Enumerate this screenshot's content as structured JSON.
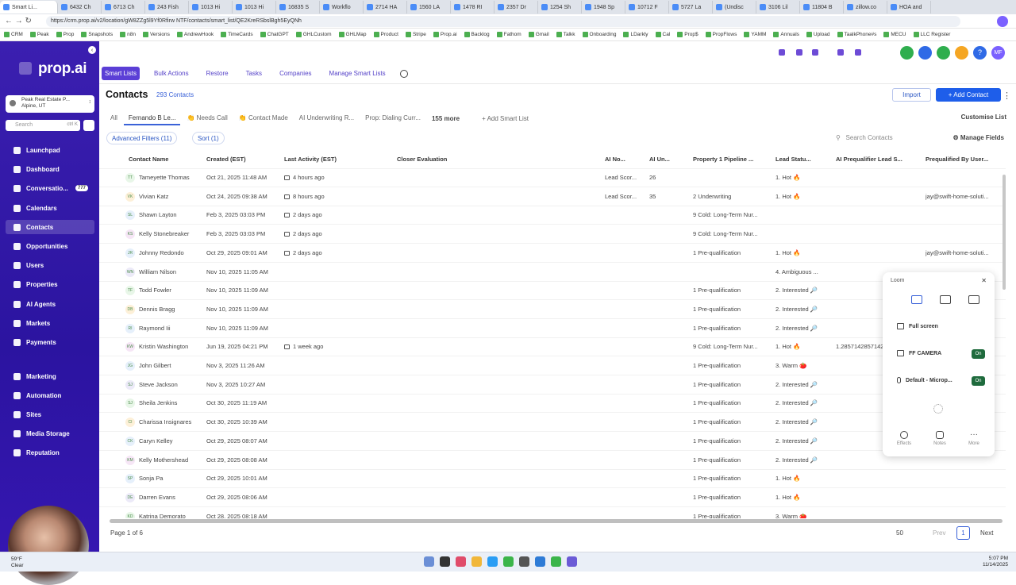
{
  "browser": {
    "tabs": [
      {
        "label": "Smart Li..."
      },
      {
        "label": "6432 Ch"
      },
      {
        "label": "6713 Ch"
      },
      {
        "label": "243 Fish"
      },
      {
        "label": "1013 Hi"
      },
      {
        "label": "1013 Hi"
      },
      {
        "label": "16835 S"
      },
      {
        "label": "Workflo"
      },
      {
        "label": "2714 HA"
      },
      {
        "label": "1560 LA"
      },
      {
        "label": "1478 RI"
      },
      {
        "label": "2357 Dr"
      },
      {
        "label": "1254 Sh"
      },
      {
        "label": "1948 Sp"
      },
      {
        "label": "10712 F"
      },
      {
        "label": "5727 La"
      },
      {
        "label": "(Undisc"
      },
      {
        "label": "3106 Lil"
      },
      {
        "label": "11804 B"
      },
      {
        "label": "zillow.co"
      },
      {
        "label": "HOA and"
      }
    ],
    "url": "https://crm.prop.ai/v2/location/gW8ZZg5l9Yf0Rfirw NTF/contacts/smart_list/QE2KreRSbslBgh5EyQNh",
    "bookmarks": [
      "CRM",
      "Peak",
      "Prop",
      "Snapshots",
      "n8n",
      "Versions",
      "AndrewHook",
      "TimeCards",
      "ChatGPT",
      "GHLCustom",
      "GHLMap",
      "Product",
      "Stripe",
      "Prop.ai",
      "Backlog",
      "Fathom",
      "Gmail",
      "Talkk",
      "Onboarding",
      "LDarkly",
      "Cal",
      "Prop$",
      "PropFlows",
      "YAMM",
      "Annuals",
      "Upload",
      "TaalkPhone#s",
      "MECU",
      "LLC Register"
    ]
  },
  "sidebar": {
    "logo": "prop.ai",
    "account_name": "Peak Real Estate P...",
    "account_location": "Alpine, UT",
    "search_placeholder": "Search",
    "search_shortcut": "ctrl K",
    "items": [
      {
        "label": "Launchpad"
      },
      {
        "label": "Dashboard"
      },
      {
        "label": "Conversatio...",
        "badge": "777"
      },
      {
        "label": "Calendars"
      },
      {
        "label": "Contacts"
      },
      {
        "label": "Opportunities"
      },
      {
        "label": "Users"
      },
      {
        "label": "Properties"
      },
      {
        "label": "AI Agents"
      },
      {
        "label": "Markets"
      },
      {
        "label": "Payments"
      },
      {
        "label": "Marketing"
      },
      {
        "label": "Automation"
      },
      {
        "label": "Sites"
      },
      {
        "label": "Media Storage"
      },
      {
        "label": "Reputation"
      }
    ]
  },
  "topbar": {
    "avatar_initials": "MF"
  },
  "subnav": {
    "tabs": [
      "Smart Lists",
      "Bulk Actions",
      "Restore",
      "Tasks",
      "Companies",
      "Manage Smart Lists"
    ]
  },
  "header": {
    "title": "Contacts",
    "count": "293 Contacts",
    "import_label": "Import",
    "add_label": "+ Add Contact"
  },
  "list_tabs": {
    "tabs": [
      "All",
      "Fernando B Le...",
      "👏 Needs Call",
      "👏 Contact Made",
      "AI Underwriting R...",
      "Prop: Dialing Curr..."
    ],
    "more": "155 more",
    "add": "+ Add Smart List",
    "customise": "Customise List"
  },
  "filters": {
    "advanced": "Advanced Filters (11)",
    "sort": "Sort (1)",
    "search_placeholder": "Search Contacts",
    "manage_fields": "Manage Fields"
  },
  "table": {
    "columns": [
      "Contact Name",
      "Created (EST)",
      "Last Activity (EST)",
      "Closer Evaluation",
      "AI No...",
      "AI Un...",
      "Property 1 Pipeline ...",
      "Lead Statu...",
      "AI Prequalifier Lead S...",
      "Prequalified By User..."
    ],
    "rows": [
      {
        "initials": "TT",
        "name": "Tameyette Thomas",
        "created": "Oct 21, 2025 11:48 AM",
        "activity": "4 hours ago",
        "ai_no": "Lead Scor...",
        "ai_un": "26",
        "pipeline": "",
        "status": "1. Hot 🔥",
        "prequal_score": "",
        "prequal_by": ""
      },
      {
        "initials": "VK",
        "name": "Vivian Katz",
        "created": "Oct 24, 2025 09:38 AM",
        "activity": "8 hours ago",
        "ai_no": "Lead Scor...",
        "ai_un": "35",
        "pipeline": "2 Underwriting",
        "status": "1. Hot 🔥",
        "prequal_score": "",
        "prequal_by": "jay@swift-home-soluti..."
      },
      {
        "initials": "SL",
        "name": "Shawn Layton",
        "created": "Feb 3, 2025 03:03 PM",
        "activity": "2 days ago",
        "ai_no": "",
        "ai_un": "",
        "pipeline": "9 Cold: Long-Term Nur...",
        "status": "",
        "prequal_score": "",
        "prequal_by": ""
      },
      {
        "initials": "KS",
        "name": "Kelly Stonebreaker",
        "created": "Feb 3, 2025 03:03 PM",
        "activity": "2 days ago",
        "ai_no": "",
        "ai_un": "",
        "pipeline": "9 Cold: Long-Term Nur...",
        "status": "",
        "prequal_score": "",
        "prequal_by": ""
      },
      {
        "initials": "JR",
        "name": "Johnny Redondo",
        "created": "Oct 29, 2025 09:01 AM",
        "activity": "2 days ago",
        "ai_no": "",
        "ai_un": "",
        "pipeline": "1 Pre-qualification",
        "status": "1. Hot 🔥",
        "prequal_score": "",
        "prequal_by": "jay@swift-home-soluti..."
      },
      {
        "initials": "WN",
        "name": "William Nilson",
        "created": "Nov 10, 2025 11:05 AM",
        "activity": "",
        "ai_no": "",
        "ai_un": "",
        "pipeline": "",
        "status": "4. Ambiguous ...",
        "prequal_score": "",
        "prequal_by": ""
      },
      {
        "initials": "TF",
        "name": "Todd Fowler",
        "created": "Nov 10, 2025 11:09 AM",
        "activity": "",
        "ai_no": "",
        "ai_un": "",
        "pipeline": "1 Pre-qualification",
        "status": "2. Interested 🔎",
        "prequal_score": "",
        "prequal_by": ""
      },
      {
        "initials": "DB",
        "name": "Dennis Bragg",
        "created": "Nov 10, 2025 11:09 AM",
        "activity": "",
        "ai_no": "",
        "ai_un": "",
        "pipeline": "1 Pre-qualification",
        "status": "2. Interested 🔎",
        "prequal_score": "",
        "prequal_by": ""
      },
      {
        "initials": "RI",
        "name": "Raymond Iii",
        "created": "Nov 10, 2025 11:09 AM",
        "activity": "",
        "ai_no": "",
        "ai_un": "",
        "pipeline": "1 Pre-qualification",
        "status": "2. Interested 🔎",
        "prequal_score": "",
        "prequal_by": ""
      },
      {
        "initials": "KW",
        "name": "Kristin Washington",
        "created": "Jun 19, 2025 04:21 PM",
        "activity": "1 week ago",
        "ai_no": "",
        "ai_un": "",
        "pipeline": "9 Cold: Long-Term Nur...",
        "status": "1. Hot 🔥",
        "prequal_score": "1.28571428571429",
        "prequal_by": ""
      },
      {
        "initials": "JG",
        "name": "John Gilbert",
        "created": "Nov 3, 2025 11:26 AM",
        "activity": "",
        "ai_no": "",
        "ai_un": "",
        "pipeline": "1 Pre-qualification",
        "status": "3. Warm 🍅",
        "prequal_score": "",
        "prequal_by": ""
      },
      {
        "initials": "SJ",
        "name": "Steve Jackson",
        "created": "Nov 3, 2025 10:27 AM",
        "activity": "",
        "ai_no": "",
        "ai_un": "",
        "pipeline": "1 Pre-qualification",
        "status": "2. Interested 🔎",
        "prequal_score": "",
        "prequal_by": ""
      },
      {
        "initials": "SJ",
        "name": "Sheila Jenkins",
        "created": "Oct 30, 2025 11:19 AM",
        "activity": "",
        "ai_no": "",
        "ai_un": "",
        "pipeline": "1 Pre-qualification",
        "status": "2. Interested 🔎",
        "prequal_score": "",
        "prequal_by": ""
      },
      {
        "initials": "CI",
        "name": "Charissa Insignares",
        "created": "Oct 30, 2025 10:39 AM",
        "activity": "",
        "ai_no": "",
        "ai_un": "",
        "pipeline": "1 Pre-qualification",
        "status": "2. Interested 🔎",
        "prequal_score": "",
        "prequal_by": ""
      },
      {
        "initials": "CK",
        "name": "Caryn Kelley",
        "created": "Oct 29, 2025 08:07 AM",
        "activity": "",
        "ai_no": "",
        "ai_un": "",
        "pipeline": "1 Pre-qualification",
        "status": "2. Interested 🔎",
        "prequal_score": "",
        "prequal_by": ""
      },
      {
        "initials": "KM",
        "name": "Kelly Mothershead",
        "created": "Oct 29, 2025 08:08 AM",
        "activity": "",
        "ai_no": "",
        "ai_un": "",
        "pipeline": "1 Pre-qualification",
        "status": "2. Interested 🔎",
        "prequal_score": "",
        "prequal_by": ""
      },
      {
        "initials": "SP",
        "name": "Sonja Pa",
        "created": "Oct 29, 2025 10:01 AM",
        "activity": "",
        "ai_no": "",
        "ai_un": "",
        "pipeline": "1 Pre-qualification",
        "status": "1. Hot 🔥",
        "prequal_score": "",
        "prequal_by": ""
      },
      {
        "initials": "DE",
        "name": "Darren Evans",
        "created": "Oct 29, 2025 08:06 AM",
        "activity": "",
        "ai_no": "",
        "ai_un": "",
        "pipeline": "1 Pre-qualification",
        "status": "1. Hot 🔥",
        "prequal_score": "",
        "prequal_by": ""
      },
      {
        "initials": "KD",
        "name": "Katrina Demorato",
        "created": "Oct 28, 2025 08:18 AM",
        "activity": "",
        "ai_no": "",
        "ai_un": "",
        "pipeline": "1 Pre-qualification",
        "status": "3. Warm 🍅",
        "prequal_score": "",
        "prequal_by": ""
      }
    ]
  },
  "footer": {
    "page_info": "Page 1 of 6",
    "page_size": "50",
    "prev": "Prev",
    "page": "1",
    "next": "Next"
  },
  "loom": {
    "title": "Loom",
    "full_screen": "Full screen",
    "camera": "FF CAMERA",
    "camera_state": "On",
    "mic": "Default - Microp...",
    "mic_state": "On",
    "effects": "Effects",
    "notes": "Notes",
    "more": "More"
  },
  "taskbar": {
    "temp": "59°F",
    "weather": "Clear",
    "time": "5:07 PM",
    "date": "11/14/2025"
  },
  "colors": {
    "sidebar": "#3b1fb0",
    "primary": "#1e5eea",
    "on_badge": "#1f6b3d"
  }
}
